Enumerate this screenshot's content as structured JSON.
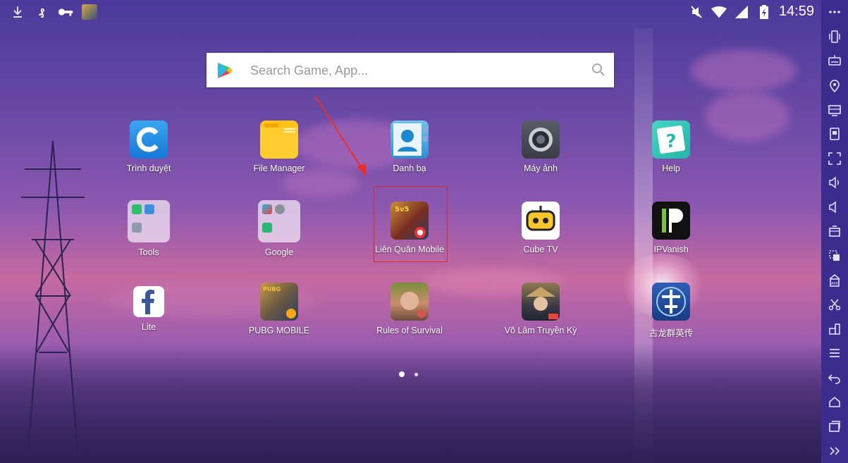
{
  "status": {
    "time": "14:59",
    "left_icons": [
      "download-icon",
      "app-logo-icon",
      "key-icon",
      "game-thumbnail-icon"
    ],
    "right_icons": [
      "mute-icon",
      "wifi-icon",
      "signal-icon",
      "battery-charging-icon"
    ]
  },
  "search": {
    "placeholder": "Search Game, App..."
  },
  "apps": [
    {
      "label": "Trình duyệt",
      "icon": "browser-icon"
    },
    {
      "label": "File Manager",
      "icon": "folder-icon"
    },
    {
      "label": "Danh bạ",
      "icon": "contacts-icon"
    },
    {
      "label": "Máy ảnh",
      "icon": "camera-icon"
    },
    {
      "label": "Help",
      "icon": "help-icon"
    },
    {
      "label": "Tools",
      "icon": "tools-folder-icon"
    },
    {
      "label": "Google",
      "icon": "google-folder-icon"
    },
    {
      "label": "Liên Quân Mobile",
      "icon": "lien-quan-icon"
    },
    {
      "label": "Cube TV",
      "icon": "cube-tv-icon"
    },
    {
      "label": "IPVanish",
      "icon": "ipvanish-icon"
    },
    {
      "label": "Lite",
      "icon": "facebook-icon"
    },
    {
      "label": "PUBG MOBILE",
      "icon": "pubg-icon"
    },
    {
      "label": "Rules of Survival",
      "icon": "rules-of-survival-icon"
    },
    {
      "label": "Võ Lâm Truyền Kỳ",
      "icon": "vo-lam-icon"
    },
    {
      "label": "古龙群英传",
      "icon": "gu-long-icon"
    }
  ],
  "pager": {
    "pages": 2,
    "current": 1
  },
  "toolbar": [
    "more-icon",
    "shake-icon",
    "keyboard-icon",
    "location-icon",
    "screen-icon",
    "screenshot-icon",
    "fullscreen-icon",
    "volume-up-icon",
    "volume-down-icon",
    "apk-install-icon",
    "multi-instance-icon",
    "import-icon",
    "scissors-icon",
    "resize-icon",
    "menu-icon",
    "back-icon",
    "home-icon",
    "recents-icon",
    "expand-icon"
  ],
  "colors": {
    "toolbar_bg": "#3b2c8e",
    "highlight": "#e02a2a",
    "arrow": "#e8302a"
  }
}
